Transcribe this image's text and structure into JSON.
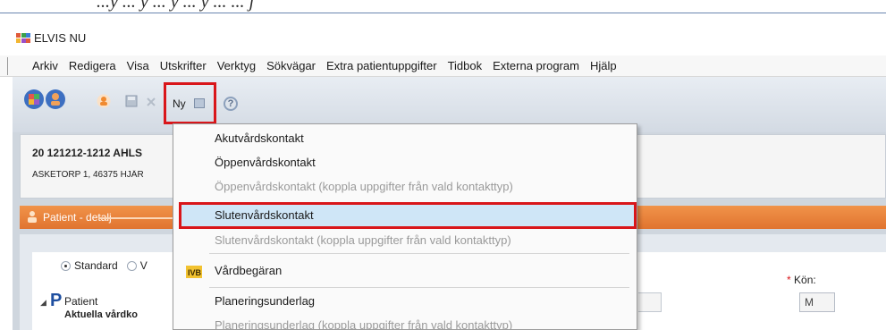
{
  "caption": "...y ... y ... y ... y ... ... j",
  "window": {
    "title": "ELVIS NU",
    "accent": "#6b85b0"
  },
  "menu": {
    "items": [
      "Arkiv",
      "Redigera",
      "Visa",
      "Utskrifter",
      "Verktyg",
      "Sökvägar",
      "Extra patientuppgifter",
      "Tidbok",
      "Externa program",
      "Hjälp"
    ]
  },
  "toolbar": {
    "ny_label": "Ny",
    "help_glyph": "?",
    "highlight_color": "#d9161a"
  },
  "patient": {
    "id_line": "20 121212-1212 AHLS",
    "address_line": "ASKETORP 1, 46375 HJÄR"
  },
  "detail_bar": {
    "label": "Patient - detalj",
    "color": "#e07430"
  },
  "view": {
    "radio_standard": "Standard",
    "radio_other": "V",
    "tree_letter": "P",
    "tree_label": "Patient",
    "tree_sub": "Aktuella vårdko"
  },
  "form": {
    "kon_star": "*",
    "kon_label": "Kön:",
    "kon_value": "M"
  },
  "dropdown": {
    "items": [
      {
        "label": "Akutvårdskontakt",
        "disabled": false
      },
      {
        "label": "Öppenvårdskontakt",
        "disabled": false
      },
      {
        "label": "Öppenvårdskontakt (koppla uppgifter från vald kontakttyp)",
        "disabled": true
      },
      {
        "label": "Slutenvårdskontakt",
        "disabled": false,
        "highlighted": true
      },
      {
        "label": "Slutenvårdskontakt (koppla uppgifter från vald kontakttyp)",
        "disabled": true
      },
      {
        "label": "Vårdbegäran",
        "disabled": false
      },
      {
        "label": "Planeringsunderlag",
        "disabled": false
      },
      {
        "label": "Planeringsunderlag (koppla uppgifter från vald kontakttyp)",
        "disabled": true
      }
    ],
    "vb_icon_text": "IVB",
    "highlight_bg": "#cfe6f7"
  }
}
